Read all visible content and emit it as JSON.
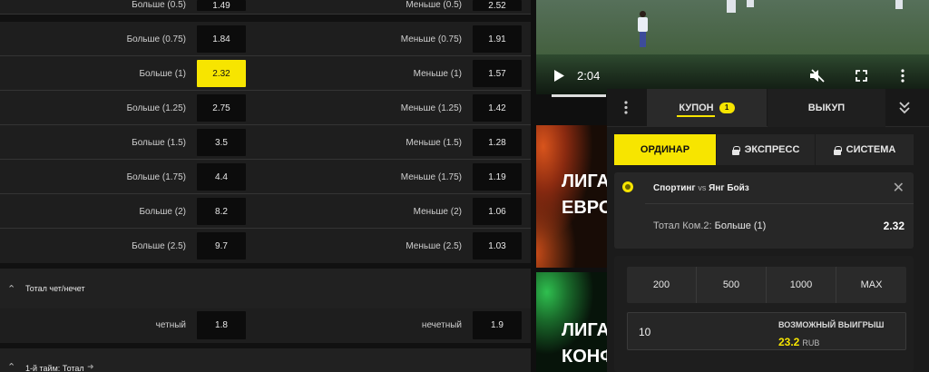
{
  "totals_rows": [
    {
      "left_label": "Больше (0.5)",
      "left_odd": "1.49",
      "right_label": "Меньше (0.5)",
      "right_odd": "2.52"
    },
    {
      "left_label": "Больше (0.75)",
      "left_odd": "1.84",
      "right_label": "Меньше (0.75)",
      "right_odd": "1.91"
    },
    {
      "left_label": "Больше (1)",
      "left_odd": "2.32",
      "right_label": "Меньше (1)",
      "right_odd": "1.57"
    },
    {
      "left_label": "Больше (1.25)",
      "left_odd": "2.75",
      "right_label": "Меньше (1.25)",
      "right_odd": "1.42"
    },
    {
      "left_label": "Больше (1.5)",
      "left_odd": "3.5",
      "right_label": "Меньше (1.5)",
      "right_odd": "1.28"
    },
    {
      "left_label": "Больше (1.75)",
      "left_odd": "4.4",
      "right_label": "Меньше (1.75)",
      "right_odd": "1.19"
    },
    {
      "left_label": "Больше (2)",
      "left_odd": "8.2",
      "right_label": "Меньше (2)",
      "right_odd": "1.06"
    },
    {
      "left_label": "Больше (2.5)",
      "left_odd": "9.7",
      "right_label": "Меньше (2.5)",
      "right_odd": "1.03"
    }
  ],
  "selected_odd": "2.32",
  "market_odd_even": {
    "title": "Тотал чет/нечет",
    "left_label": "четный",
    "left_odd": "1.8",
    "right_label": "нечетный",
    "right_odd": "1.9"
  },
  "market_first_half": {
    "title": "1-й тайм: Тотал"
  },
  "video": {
    "time": "2:04",
    "progress": 0.14
  },
  "promos": [
    {
      "line1": "ЛИГА",
      "line2": "ЕВРОП"
    },
    {
      "line1": "ЛИГА",
      "line2": "КОНФ"
    }
  ],
  "betslip": {
    "tabs": {
      "kupon": "КУПОН",
      "kupon_count": "1",
      "vykup": "ВЫКУП"
    },
    "types": {
      "single": "ОРДИНАР",
      "express": "ЭКСПРЕСС",
      "system": "СИСТЕМА"
    },
    "bet": {
      "home": "Спортинг",
      "vs": "vs",
      "away": "Янг Бойз",
      "market": "Тотал Ком.2:",
      "selection": "Больше (1)",
      "odd": "2.32"
    },
    "quick_amounts": [
      "200",
      "500",
      "1000",
      "MAX"
    ],
    "stake": "10",
    "win_label": "ВОЗМОЖНЫЙ ВЫИГРЫШ",
    "win_value": "23.2",
    "currency": "RUB"
  },
  "colors": {
    "accent": "#f7e500",
    "background": "#0f0f0f",
    "panel": "#1e1e1e"
  }
}
